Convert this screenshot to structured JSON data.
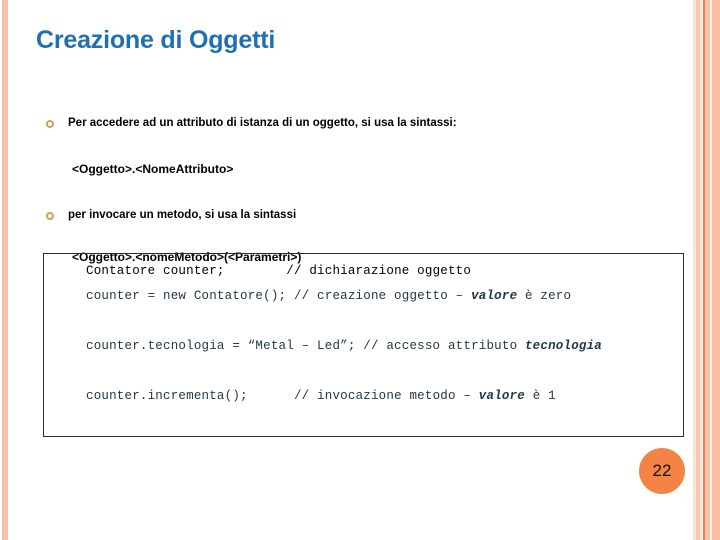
{
  "slide": {
    "title": "Creazione di Oggetti",
    "page_number": "22",
    "accent_blue": "#1f6fb5",
    "accent_orange": "#f58345",
    "stripe_peach": "#f9bda2",
    "bullet_ring": "#d99a5b"
  },
  "bullets": [
    {
      "text": "Per accedere ad un attributo di istanza di un oggetto, si usa la sintassi:"
    },
    {
      "text": "per invocare un metodo, si usa la sintassi"
    }
  ],
  "syntax": [
    {
      "text": "<Oggetto>.<NomeAttributo>"
    },
    {
      "text": "<Oggetto>.<nomeMetodo>(<Parametri>)"
    }
  ],
  "code": {
    "line1": {
      "code": "Contatore counter;",
      "gap": "        ",
      "comment": "// dichiarazione oggetto"
    },
    "line2": {
      "code": "counter = new Contatore();",
      "gap": " ",
      "comment_pre": "// creazione oggetto – ",
      "comment_em": "valore",
      "comment_post": " è zero"
    },
    "line3": {
      "code": "counter.tecnologia = “Metal – Led”;",
      "gap": " ",
      "comment_pre": "// accesso attributo ",
      "comment_em": "tecnologia",
      "comment_post": ""
    },
    "line4": {
      "code": "counter.incrementa();",
      "gap": "      ",
      "comment_pre": "// invocazione metodo – ",
      "comment_em": "valore",
      "comment_post": " è 1"
    }
  }
}
